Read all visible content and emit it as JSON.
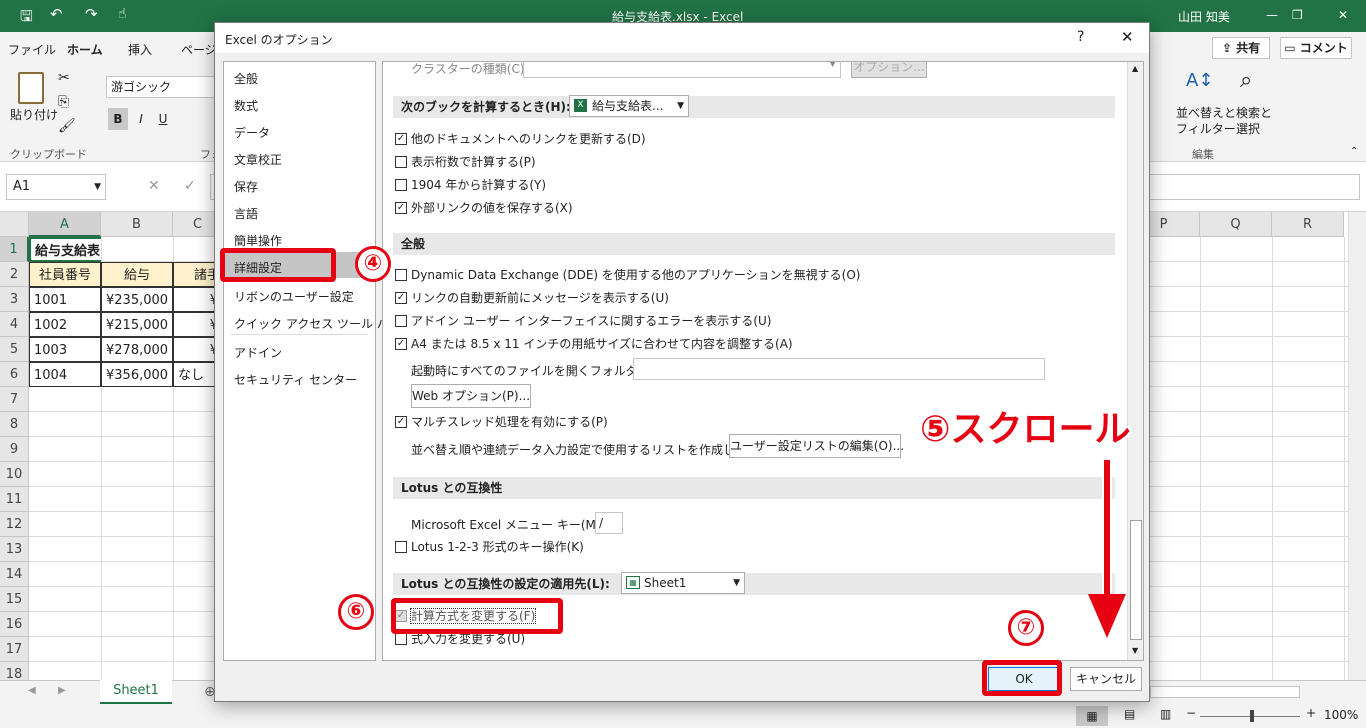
{
  "window": {
    "title": "給与支給表.xlsx  -  Excel",
    "user": "山田 知美"
  },
  "menu": {
    "tabs": [
      "ファイル",
      "ホーム",
      "挿入",
      "ページ"
    ],
    "share": "共有",
    "comment": "コメント"
  },
  "ribbon": {
    "paste": "貼り付け",
    "clipboard": "クリップボード",
    "font_name": "游ゴシック",
    "bold": "B",
    "italic": "I",
    "underline": "U",
    "font_group": "フォ",
    "sort_filter": "並べ替えと",
    "sort_filter2": "フィルター",
    "find_select": "検索と",
    "find_select2": "選択",
    "edit_group": "編集"
  },
  "formula_bar": {
    "name_box": "A1"
  },
  "grid": {
    "columns": [
      "A",
      "B",
      "C"
    ],
    "right_columns": [
      "P",
      "Q",
      "R"
    ],
    "rows": [
      "1",
      "2",
      "3",
      "4",
      "5",
      "6",
      "7",
      "8",
      "9",
      "10",
      "11",
      "12",
      "13",
      "14",
      "15",
      "16",
      "17",
      "18"
    ],
    "cells": {
      "a1": "給与支給表",
      "a2": "社員番号",
      "b2": "給与",
      "c2": "諸手",
      "a3": "1001",
      "b3": "¥235,000",
      "c3": "¥",
      "a4": "1002",
      "b4": "¥215,000",
      "c4": "¥",
      "a5": "1003",
      "b5": "¥278,000",
      "c5": "¥",
      "a6": "1004",
      "b6": "¥356,000",
      "c6": "なし"
    }
  },
  "sheet_tab": "Sheet1",
  "zoom": "100%",
  "dialog": {
    "title": "Excel のオプション",
    "help": "?",
    "close": "✕",
    "nav": [
      "全般",
      "数式",
      "データ",
      "文章校正",
      "保存",
      "言語",
      "簡単操作",
      "詳細設定",
      "リボンのユーザー設定",
      "クイック アクセス ツール バー",
      "アドイン",
      "セキュリティ センター"
    ],
    "cluster_label": "クラスターの種類(C):",
    "option_btn": "オプション...",
    "section_calc": "次のブックを計算するとき(H):",
    "workbook": "給与支給表...",
    "calc_options": [
      {
        "label": "他のドキュメントへのリンクを更新する(D)",
        "checked": true
      },
      {
        "label": "表示桁数で計算する(P)",
        "checked": false
      },
      {
        "label": "1904 年から計算する(Y)",
        "checked": false
      },
      {
        "label": "外部リンクの値を保存する(X)",
        "checked": true
      }
    ],
    "section_general": "全般",
    "general_options": [
      {
        "label": "Dynamic Data Exchange (DDE) を使用する他のアプリケーションを無視する(O)",
        "checked": false
      },
      {
        "label": "リンクの自動更新前にメッセージを表示する(U)",
        "checked": true
      },
      {
        "label": "アドイン ユーザー インターフェイスに関するエラーを表示する(U)",
        "checked": false
      },
      {
        "label": "A4 または 8.5 x 11 インチの用紙サイズに合わせて内容を調整する(A)",
        "checked": true
      }
    ],
    "startup_label": "起動時にすべてのファイルを開くフォルダー(L):",
    "web_options": "Web オプション(P)...",
    "multithread": "マルチスレッド処理を有効にする(P)",
    "custom_list_label": "並べ替え順や連続データ入力設定で使用するリストを作成します:",
    "custom_list_btn": "ユーザー設定リストの編集(O)...",
    "section_lotus": "Lotus との互換性",
    "menu_key_label": "Microsoft Excel メニュー キー(M):",
    "menu_key_value": "/",
    "lotus_keys": "Lotus 1-2-3 形式のキー操作(K)",
    "section_lotus_apply": "Lotus との互換性の設定の適用先(L):",
    "sheet_select": "Sheet1",
    "calc_change": "計算方式を変更する(F)",
    "formula_entry": "式入力を変更する(U)",
    "ok": "OK",
    "cancel": "キャンセル"
  },
  "annotations": {
    "step4": "④",
    "step5": "⑤スクロール",
    "step6": "⑥",
    "step7": "⑦",
    "color": "#e60012"
  }
}
